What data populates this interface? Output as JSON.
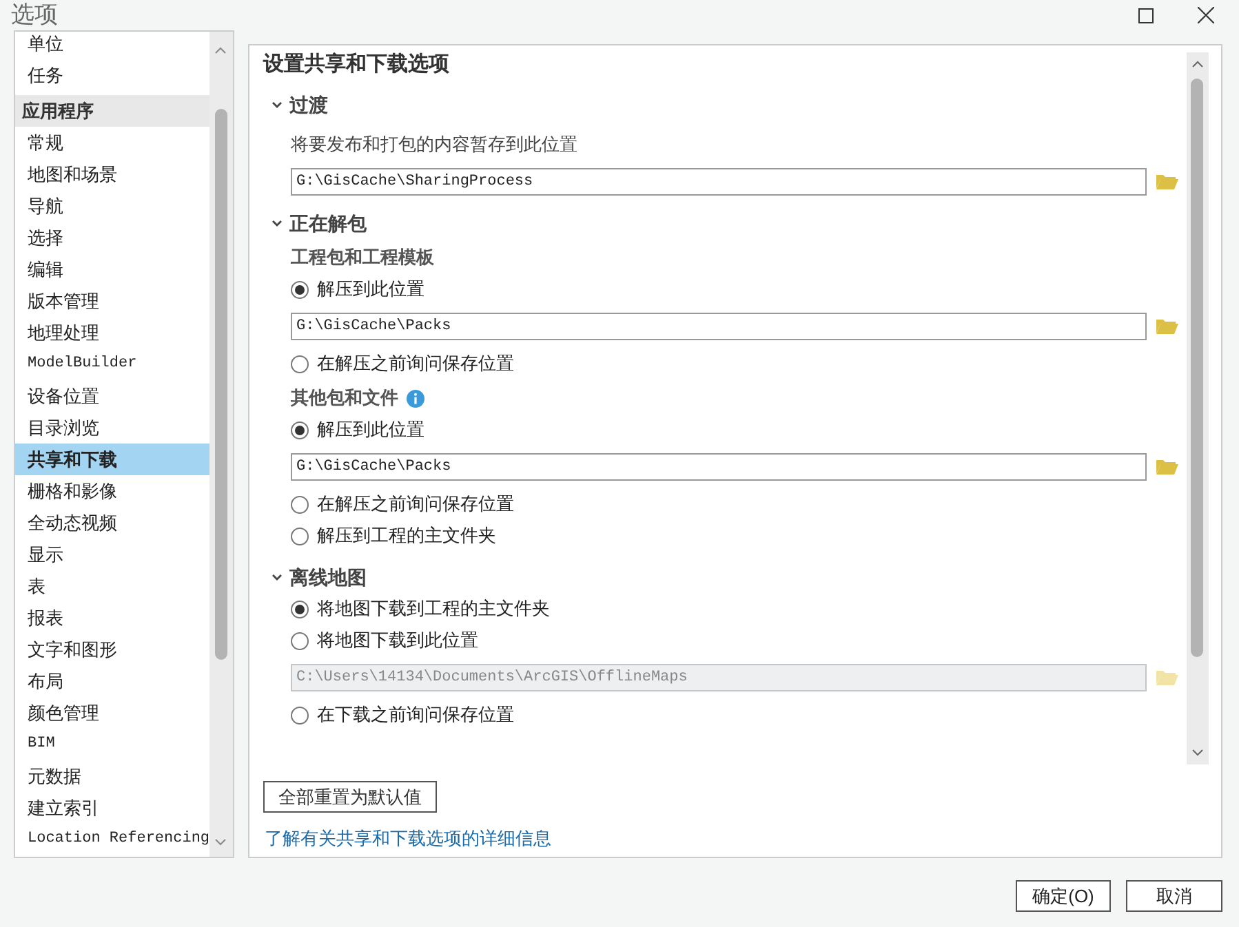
{
  "window": {
    "title": "选项"
  },
  "sidebar": {
    "items": [
      {
        "label": "单位",
        "kind": "item",
        "selected": false
      },
      {
        "label": "任务",
        "kind": "item",
        "selected": false
      },
      {
        "label": "应用程序",
        "kind": "header"
      },
      {
        "label": "常规",
        "kind": "item",
        "selected": false
      },
      {
        "label": "地图和场景",
        "kind": "item",
        "selected": false
      },
      {
        "label": "导航",
        "kind": "item",
        "selected": false
      },
      {
        "label": "选择",
        "kind": "item",
        "selected": false
      },
      {
        "label": "编辑",
        "kind": "item",
        "selected": false
      },
      {
        "label": "版本管理",
        "kind": "item",
        "selected": false
      },
      {
        "label": "地理处理",
        "kind": "item",
        "selected": false
      },
      {
        "label": "ModelBuilder",
        "kind": "item",
        "selected": false
      },
      {
        "label": "设备位置",
        "kind": "item",
        "selected": false
      },
      {
        "label": "目录浏览",
        "kind": "item",
        "selected": false
      },
      {
        "label": "共享和下载",
        "kind": "item",
        "selected": true
      },
      {
        "label": "栅格和影像",
        "kind": "item",
        "selected": false
      },
      {
        "label": "全动态视频",
        "kind": "item",
        "selected": false
      },
      {
        "label": "显示",
        "kind": "item",
        "selected": false
      },
      {
        "label": "表",
        "kind": "item",
        "selected": false
      },
      {
        "label": "报表",
        "kind": "item",
        "selected": false
      },
      {
        "label": "文字和图形",
        "kind": "item",
        "selected": false
      },
      {
        "label": "布局",
        "kind": "item",
        "selected": false
      },
      {
        "label": "颜色管理",
        "kind": "item",
        "selected": false
      },
      {
        "label": "BIM",
        "kind": "item",
        "selected": false
      },
      {
        "label": "元数据",
        "kind": "item",
        "selected": false
      },
      {
        "label": "建立索引",
        "kind": "item",
        "selected": false
      },
      {
        "label": "Location Referencing",
        "kind": "item",
        "selected": false
      }
    ]
  },
  "content": {
    "title": "设置共享和下载选项",
    "sections": [
      {
        "title": "过渡",
        "expanded": true,
        "items": [
          {
            "kind": "text",
            "label": "将要发布和打包的内容暂存到此位置"
          },
          {
            "kind": "path",
            "value": "G:\\GisCache\\SharingProcess",
            "disabled": false
          }
        ]
      },
      {
        "title": "正在解包",
        "expanded": true,
        "items": [
          {
            "kind": "subheading",
            "label": "工程包和工程模板",
            "info": false
          },
          {
            "kind": "radio",
            "label": "解压到此位置",
            "selected": true
          },
          {
            "kind": "path",
            "value": "G:\\GisCache\\Packs",
            "disabled": false
          },
          {
            "kind": "radio",
            "label": "在解压之前询问保存位置",
            "selected": false
          },
          {
            "kind": "subheading",
            "label": "其他包和文件",
            "info": true
          },
          {
            "kind": "radio",
            "label": "解压到此位置",
            "selected": true
          },
          {
            "kind": "path",
            "value": "G:\\GisCache\\Packs",
            "disabled": false
          },
          {
            "kind": "radio",
            "label": "在解压之前询问保存位置",
            "selected": false
          },
          {
            "kind": "radio",
            "label": "解压到工程的主文件夹",
            "selected": false
          }
        ]
      },
      {
        "title": "离线地图",
        "expanded": true,
        "items": [
          {
            "kind": "radio",
            "label": "将地图下载到工程的主文件夹",
            "selected": true
          },
          {
            "kind": "radio",
            "label": "将地图下载到此位置",
            "selected": false
          },
          {
            "kind": "path",
            "value": "C:\\Users\\14134\\Documents\\ArcGIS\\OfflineMaps",
            "disabled": true
          },
          {
            "kind": "radio",
            "label": "在下载之前询问保存位置",
            "selected": false
          }
        ]
      }
    ],
    "reset_button": "全部重置为默认值",
    "help_link": "了解有关共享和下载选项的详细信息"
  },
  "buttons": [
    "确定(O)",
    "取消"
  ]
}
